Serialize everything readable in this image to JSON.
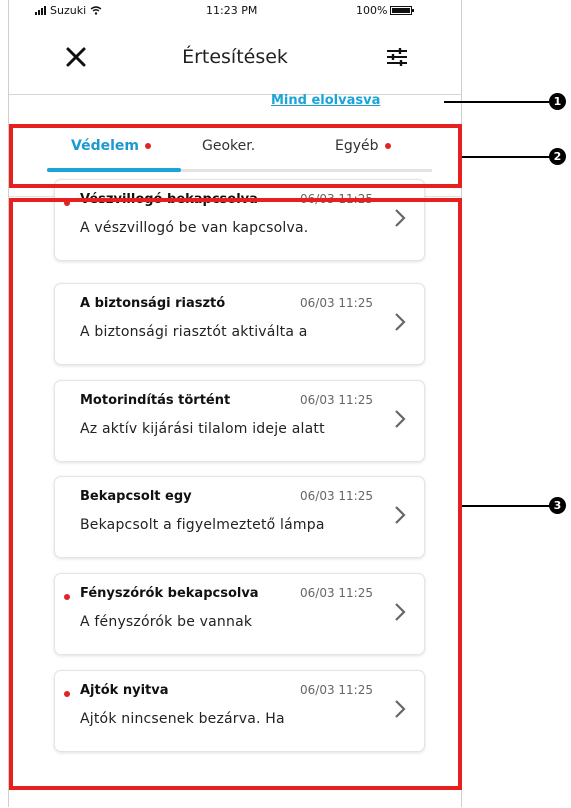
{
  "status_bar": {
    "carrier": "Suzuki",
    "time": "11:23 PM",
    "battery": "100%"
  },
  "header": {
    "title": "Értesítések",
    "close_icon": "close-icon",
    "filter_icon": "sliders-icon"
  },
  "mark_all_read": "Mind elolvasva",
  "tabs": [
    {
      "label": "Védelem",
      "active": true,
      "has_unread": true
    },
    {
      "label": "Geoker.",
      "active": false,
      "has_unread": false
    },
    {
      "label": "Egyéb",
      "active": false,
      "has_unread": true
    }
  ],
  "notifications": [
    {
      "title": "Vészvillogó bekapcsolva",
      "date": "06/03 11:25",
      "body": "A vészvillogó be van kapcsolva.",
      "unread": true
    },
    {
      "title": "A biztonsági riasztó",
      "date": "06/03 11:25",
      "body": "A biztonsági riasztót aktiválta a",
      "unread": false
    },
    {
      "title": "Motorindítás történt",
      "date": "06/03 11:25",
      "body": "Az aktív kijárási tilalom ideje alatt",
      "unread": false
    },
    {
      "title": "Bekapcsolt egy",
      "date": "06/03 11:25",
      "body": "Bekapcsolt a figyelmeztető lámpa",
      "unread": false
    },
    {
      "title": "Fényszórók bekapcsolva",
      "date": "06/03 11:25",
      "body": "A fényszórók be vannak",
      "unread": true
    },
    {
      "title": "Ajtók nyitva",
      "date": "06/03 11:25",
      "body": "Ajtók nincsenek bezárva. Ha",
      "unread": true
    }
  ],
  "annotations": [
    "1",
    "2",
    "3"
  ],
  "colors": {
    "accent": "#1aa4d8",
    "unread_dot": "#e02424",
    "annotation_box": "#e81f1f"
  }
}
